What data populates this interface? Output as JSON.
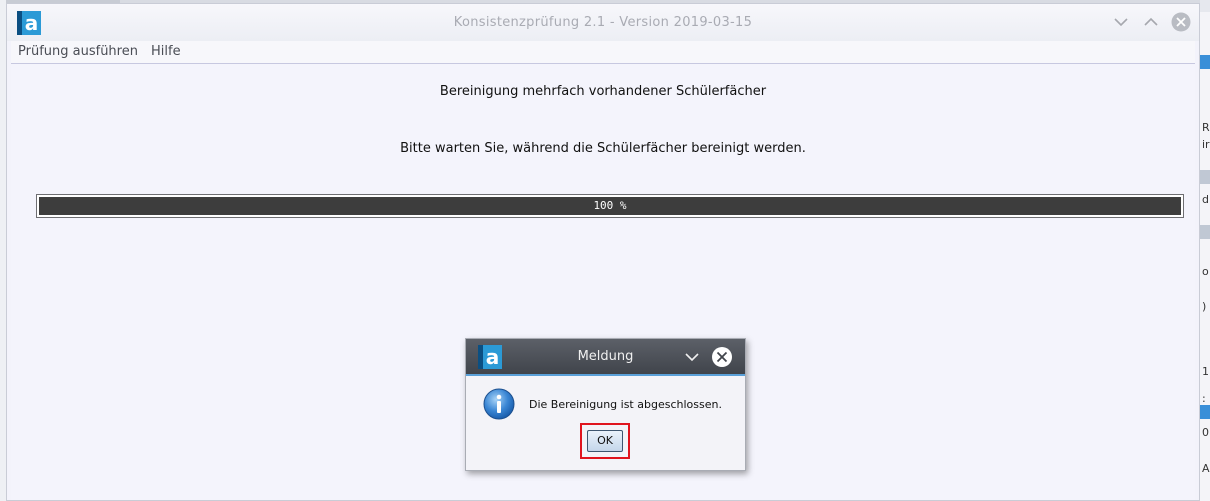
{
  "window": {
    "title": "Konsistenzprüfung 2.1 - Version 2019-03-15"
  },
  "menu": {
    "items": [
      "Prüfung ausführen",
      "Hilfe"
    ]
  },
  "main": {
    "heading": "Bereinigung mehrfach vorhandener Schülerfächer",
    "status_text": "Bitte warten Sie, während die Schülerfächer bereinigt werden.",
    "progress": {
      "percent": 100,
      "label": "100 %"
    }
  },
  "dialog": {
    "title": "Meldung",
    "message": "Die Bereinigung ist abgeschlossen.",
    "ok_label": "OK",
    "icon": "info-icon"
  },
  "background_app": {
    "fragments": [
      "R",
      "ir",
      "d",
      "o",
      ")",
      "1",
      ":",
      "0",
      "A"
    ]
  },
  "colors": {
    "accent": "#2b9ad6",
    "highlight": "#e0141e",
    "progress_fill": "#3d3d3d"
  }
}
